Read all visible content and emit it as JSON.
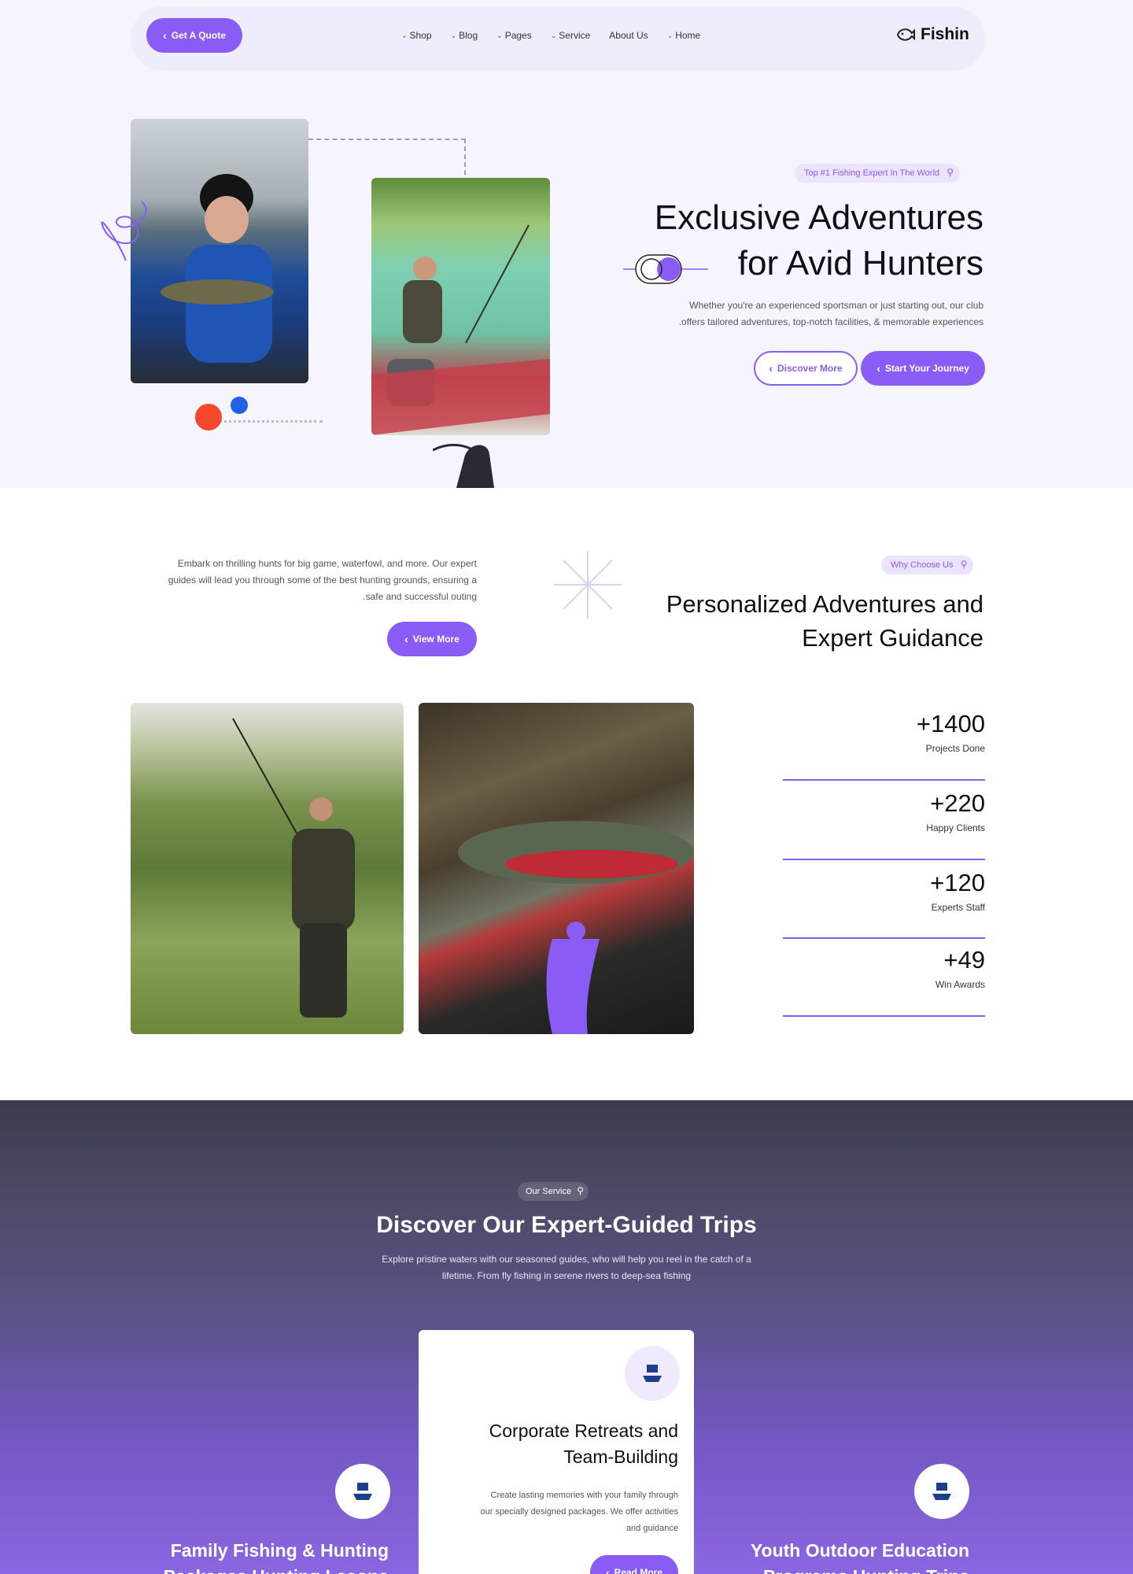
{
  "nav": {
    "quote_label": "Get A Quote",
    "menu": [
      "Shop",
      "Blog",
      "Pages",
      "Service",
      "About Us",
      "Home"
    ],
    "brand": "Fishin"
  },
  "hero": {
    "badge": "Top #1 Fishing Expert In The World",
    "title_line1": "Exclusive Adventures",
    "title_line2": "for Avid Hunters",
    "description_line1": "Whether you're an experienced sportsman or just starting out, our club",
    "description_line2": ".offers tailored adventures, top-notch facilities, & memorable experiences",
    "discover_label": "Discover More",
    "journey_label": "Start Your Journey"
  },
  "about": {
    "text_line1": "Embark on thrilling hunts for big game, waterfowl, and more. Our expert",
    "text_line2": "guides will lead you through some of the best hunting grounds, ensuring a",
    "text_line3": ".safe and successful outing",
    "view_more_label": "View More",
    "badge": "Why Choose Us",
    "title_line1": "Personalized Adventures and",
    "title_line2": "Expert Guidance",
    "stats": [
      {
        "value": "+1400",
        "label": "Projects Done"
      },
      {
        "value": "+220",
        "label": "Happy Clients"
      },
      {
        "value": "+120",
        "label": "Experts Staff"
      },
      {
        "value": "+49",
        "label": "Win Awards"
      }
    ]
  },
  "services": {
    "badge": "Our Service",
    "title": "Discover Our Expert-Guided Trips",
    "desc_line1": "Explore pristine waters with our seasoned guides, who will help you reel in the catch of a",
    "desc_line2": "lifetime. From fly fishing in serene rivers to deep-sea fishing",
    "card": {
      "title_line1": "Corporate Retreats and",
      "title_line2": "Team-Building",
      "desc_line1": "Create lasting memories with your family through",
      "desc_line2": "our specially designed packages. We offer activities",
      "desc_line3": "and guidance",
      "button_label": "Read More"
    },
    "left_title_line1": "Family Fishing & Hunting",
    "left_title_line2": "Packages Hunting Lesons",
    "right_title_line1": "Youth Outdoor Education",
    "right_title_line2": "Programs Hunting Trips"
  },
  "colors": {
    "accent": "#8a5cf6",
    "hero_bg": "#f6f4fc",
    "dot_red": "#f4472c",
    "dot_blue": "#1f62e6"
  },
  "icons": [
    "chevron-left-icon",
    "caret-down-icon",
    "fishing-hook-icon",
    "fish-logo-icon",
    "boat-icon"
  ]
}
